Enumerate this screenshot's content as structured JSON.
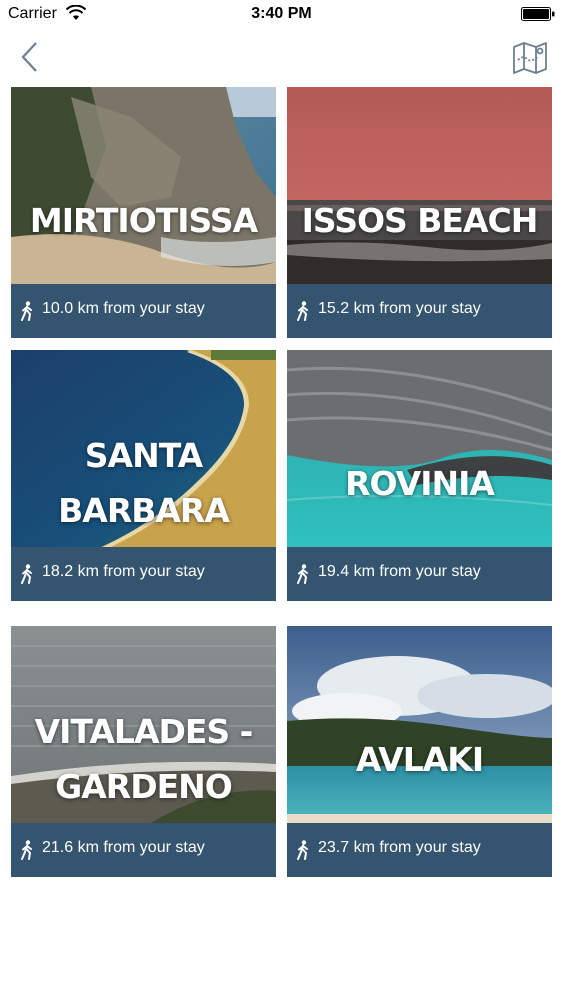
{
  "status": {
    "carrier": "Carrier",
    "time": "3:40 PM"
  },
  "nav": {
    "back_icon": "chevron-left-icon",
    "map_icon": "map-icon"
  },
  "beaches": [
    {
      "name": "MIRTIOTISSA",
      "distance": "10.0 km from your stay"
    },
    {
      "name": "ISSOS BEACH",
      "distance": "15.2 km from your stay"
    },
    {
      "name_lines": [
        "SANTA",
        "BARBARA"
      ],
      "distance": "18.2 km from your stay"
    },
    {
      "name": "ROVINIA",
      "distance": "19.4 km from your stay"
    },
    {
      "name_lines": [
        "VITALADES -",
        "GARDENO"
      ],
      "distance": "21.6 km from your stay"
    },
    {
      "name": "AVLAKI",
      "distance": "23.7 km from your stay"
    }
  ],
  "colors": {
    "footer": "#34546f",
    "text": "#ffffff"
  }
}
